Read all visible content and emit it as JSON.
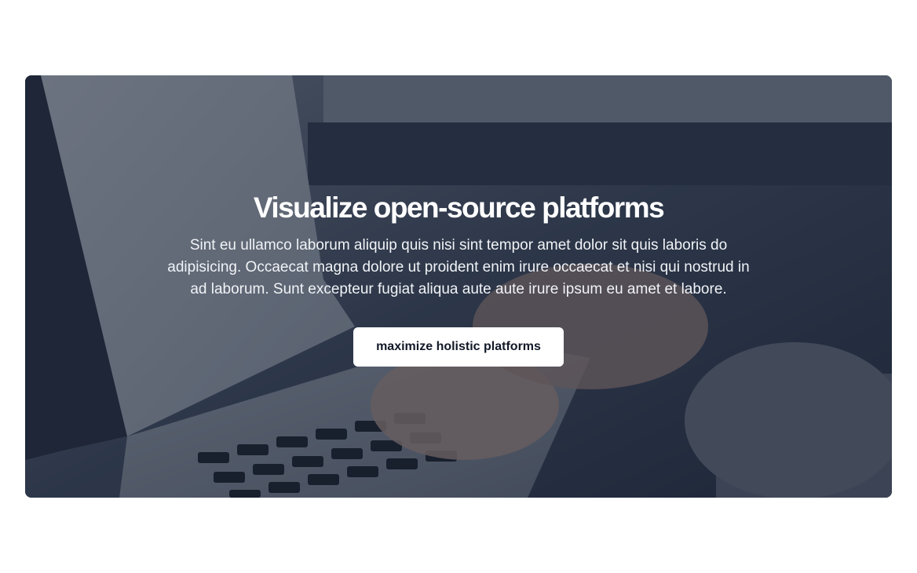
{
  "hero": {
    "title": "Visualize open-source platforms",
    "description": "Sint eu ullamco laborum aliquip quis nisi sint tempor amet dolor sit quis laboris do adipisicing. Occaecat magna dolore ut proident enim irure occaecat et nisi qui nostrud in ad laborum. Sunt excepteur fugiat aliqua aute aute irure ipsum eu amet et labore.",
    "cta_label": "maximize holistic platforms",
    "overlay_color": "#1e2a3c",
    "button_color": "#ffffff",
    "background_image": "laptop-typing-photo"
  }
}
